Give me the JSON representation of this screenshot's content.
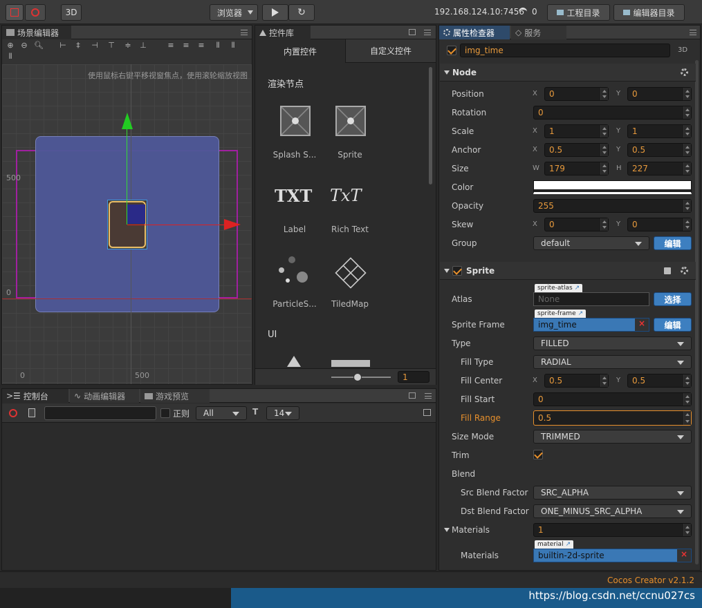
{
  "toolbar": {
    "mode_3d": "3D",
    "preview_select": "浏览器",
    "ip": "192.168.124.10:7456",
    "wifi_count": "0",
    "project_dir": "工程目录",
    "editor_dir": "编辑器目录"
  },
  "scene": {
    "tab": "场景编辑器",
    "hint": "使用鼠标右键平移视窗焦点，使用滚轮缩放视图",
    "y_500": "500",
    "y_0": "0",
    "x_0": "0",
    "x_500": "500"
  },
  "library": {
    "tab": "控件库",
    "tab_builtin": "内置控件",
    "tab_custom": "自定义控件",
    "section_render": "渲染节点",
    "section_ui": "UI",
    "items": [
      {
        "label": "Splash S..."
      },
      {
        "label": "Sprite"
      },
      {
        "label": "Label"
      },
      {
        "label": "Rich Text"
      },
      {
        "label": "ParticleS..."
      },
      {
        "label": "TiledMap"
      }
    ],
    "zoom_value": "1",
    "txt_icon": "TXT",
    "rich_icon": "TxT"
  },
  "console": {
    "tab_console": "控制台",
    "tab_anim": "动画编辑器",
    "tab_preview": "游戏预览",
    "regex": "正则",
    "level": "All",
    "font_size": "14"
  },
  "inspector": {
    "tab_inspector": "属性检查器",
    "tab_service": "服务",
    "node_name": "img_time",
    "label_3d": "3D",
    "node_section": "Node",
    "props": {
      "position": "Position",
      "rotation": "Rotation",
      "scale": "Scale",
      "anchor": "Anchor",
      "size": "Size",
      "color": "Color",
      "opacity": "Opacity",
      "skew": "Skew",
      "group": "Group"
    },
    "values": {
      "pos_x": "0",
      "pos_y": "0",
      "rotation": "0",
      "scale_x": "1",
      "scale_y": "1",
      "anchor_x": "0.5",
      "anchor_y": "0.5",
      "size_w": "179",
      "size_h": "227",
      "opacity": "255",
      "skew_x": "0",
      "skew_y": "0",
      "group": "default"
    },
    "axis": {
      "x": "X",
      "y": "Y",
      "w": "W",
      "h": "H"
    },
    "edit": "编辑",
    "select": "选择",
    "sprite_section": "Sprite",
    "sprite_props": {
      "atlas": "Atlas",
      "sprite_frame": "Sprite Frame",
      "type": "Type",
      "fill_type": "Fill Type",
      "fill_center": "Fill Center",
      "fill_start": "Fill Start",
      "fill_range": "Fill Range",
      "size_mode": "Size Mode",
      "trim": "Trim",
      "blend": "Blend",
      "src_blend": "Src Blend Factor",
      "dst_blend": "Dst Blend Factor",
      "materials": "Materials",
      "materials_item": "Materials"
    },
    "sprite_values": {
      "atlas_tag": "sprite-atlas",
      "atlas": "None",
      "frame_tag": "sprite-frame",
      "frame": "img_time",
      "type": "FILLED",
      "fill_type": "RADIAL",
      "fill_center_x": "0.5",
      "fill_center_y": "0.5",
      "fill_start": "0",
      "fill_range": "0.5",
      "size_mode": "TRIMMED",
      "src_blend": "SRC_ALPHA",
      "dst_blend": "ONE_MINUS_SRC_ALPHA",
      "materials_count": "1",
      "material_tag": "material",
      "material": "builtin-2d-sprite"
    }
  },
  "status": {
    "version": "Cocos Creator v2.1.2",
    "watermark": "https://blog.csdn.net/ccnu027cs"
  },
  "colors": {
    "accent": "#e8902c",
    "blue": "#3d7fc0",
    "bg": "#282828"
  }
}
